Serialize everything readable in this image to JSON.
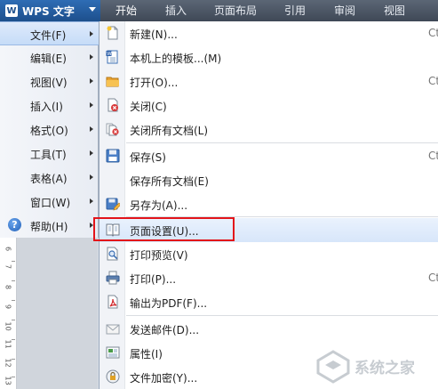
{
  "app_menu": {
    "logo_letter": "W",
    "label": "WPS 文字"
  },
  "ribbon_tabs": [
    "开始",
    "插入",
    "页面布局",
    "引用",
    "审阅",
    "视图"
  ],
  "left_menu": [
    {
      "label": "文件(F)",
      "selected": true,
      "icon": ""
    },
    {
      "label": "编辑(E)",
      "selected": false,
      "icon": ""
    },
    {
      "label": "视图(V)",
      "selected": false,
      "icon": ""
    },
    {
      "label": "插入(I)",
      "selected": false,
      "icon": ""
    },
    {
      "label": "格式(O)",
      "selected": false,
      "icon": ""
    },
    {
      "label": "工具(T)",
      "selected": false,
      "icon": ""
    },
    {
      "label": "表格(A)",
      "selected": false,
      "icon": ""
    },
    {
      "label": "窗口(W)",
      "selected": false,
      "icon": ""
    },
    {
      "label": "帮助(H)",
      "selected": false,
      "icon": "help-icon"
    }
  ],
  "help_icon_glyph": "?",
  "file_menu": [
    {
      "label": "新建(N)...",
      "icon": "new-document-icon",
      "shortcut": "Ct"
    },
    {
      "label": "本机上的模板...(M)",
      "icon": "template-icon",
      "shortcut": ""
    },
    {
      "label": "打开(O)...",
      "icon": "open-folder-icon",
      "shortcut": "Ct"
    },
    {
      "label": "关闭(C)",
      "icon": "close-document-icon",
      "shortcut": ""
    },
    {
      "label": "关闭所有文档(L)",
      "icon": "close-all-documents-icon",
      "shortcut": ""
    },
    {
      "label": "保存(S)",
      "icon": "save-icon",
      "shortcut": "Ct"
    },
    {
      "label": "保存所有文档(E)",
      "icon": "",
      "shortcut": ""
    },
    {
      "label": "另存为(A)...",
      "icon": "save-as-icon",
      "shortcut": ""
    },
    {
      "label": "页面设置(U)...",
      "icon": "page-setup-icon",
      "shortcut": ""
    },
    {
      "label": "打印预览(V)",
      "icon": "print-preview-icon",
      "shortcut": ""
    },
    {
      "label": "打印(P)...",
      "icon": "printer-icon",
      "shortcut": "Ct"
    },
    {
      "label": "输出为PDF(F)...",
      "icon": "pdf-export-icon",
      "shortcut": ""
    },
    {
      "label": "发送邮件(D)...",
      "icon": "email-icon",
      "shortcut": ""
    },
    {
      "label": "属性(I)",
      "icon": "properties-icon",
      "shortcut": ""
    },
    {
      "label": "文件加密(Y)...",
      "icon": "encrypt-file-icon",
      "shortcut": ""
    }
  ],
  "highlighted_item": "页面设置(U)...",
  "ruler_numbers": [
    "6",
    "7",
    "8",
    "9",
    "10",
    "11",
    "12",
    "13"
  ],
  "watermark": "系统之家",
  "colors": {
    "highlight_border": "#e3141a",
    "wps_blue": "#1d4f8c",
    "ribbon_dark": "#3f4856"
  }
}
